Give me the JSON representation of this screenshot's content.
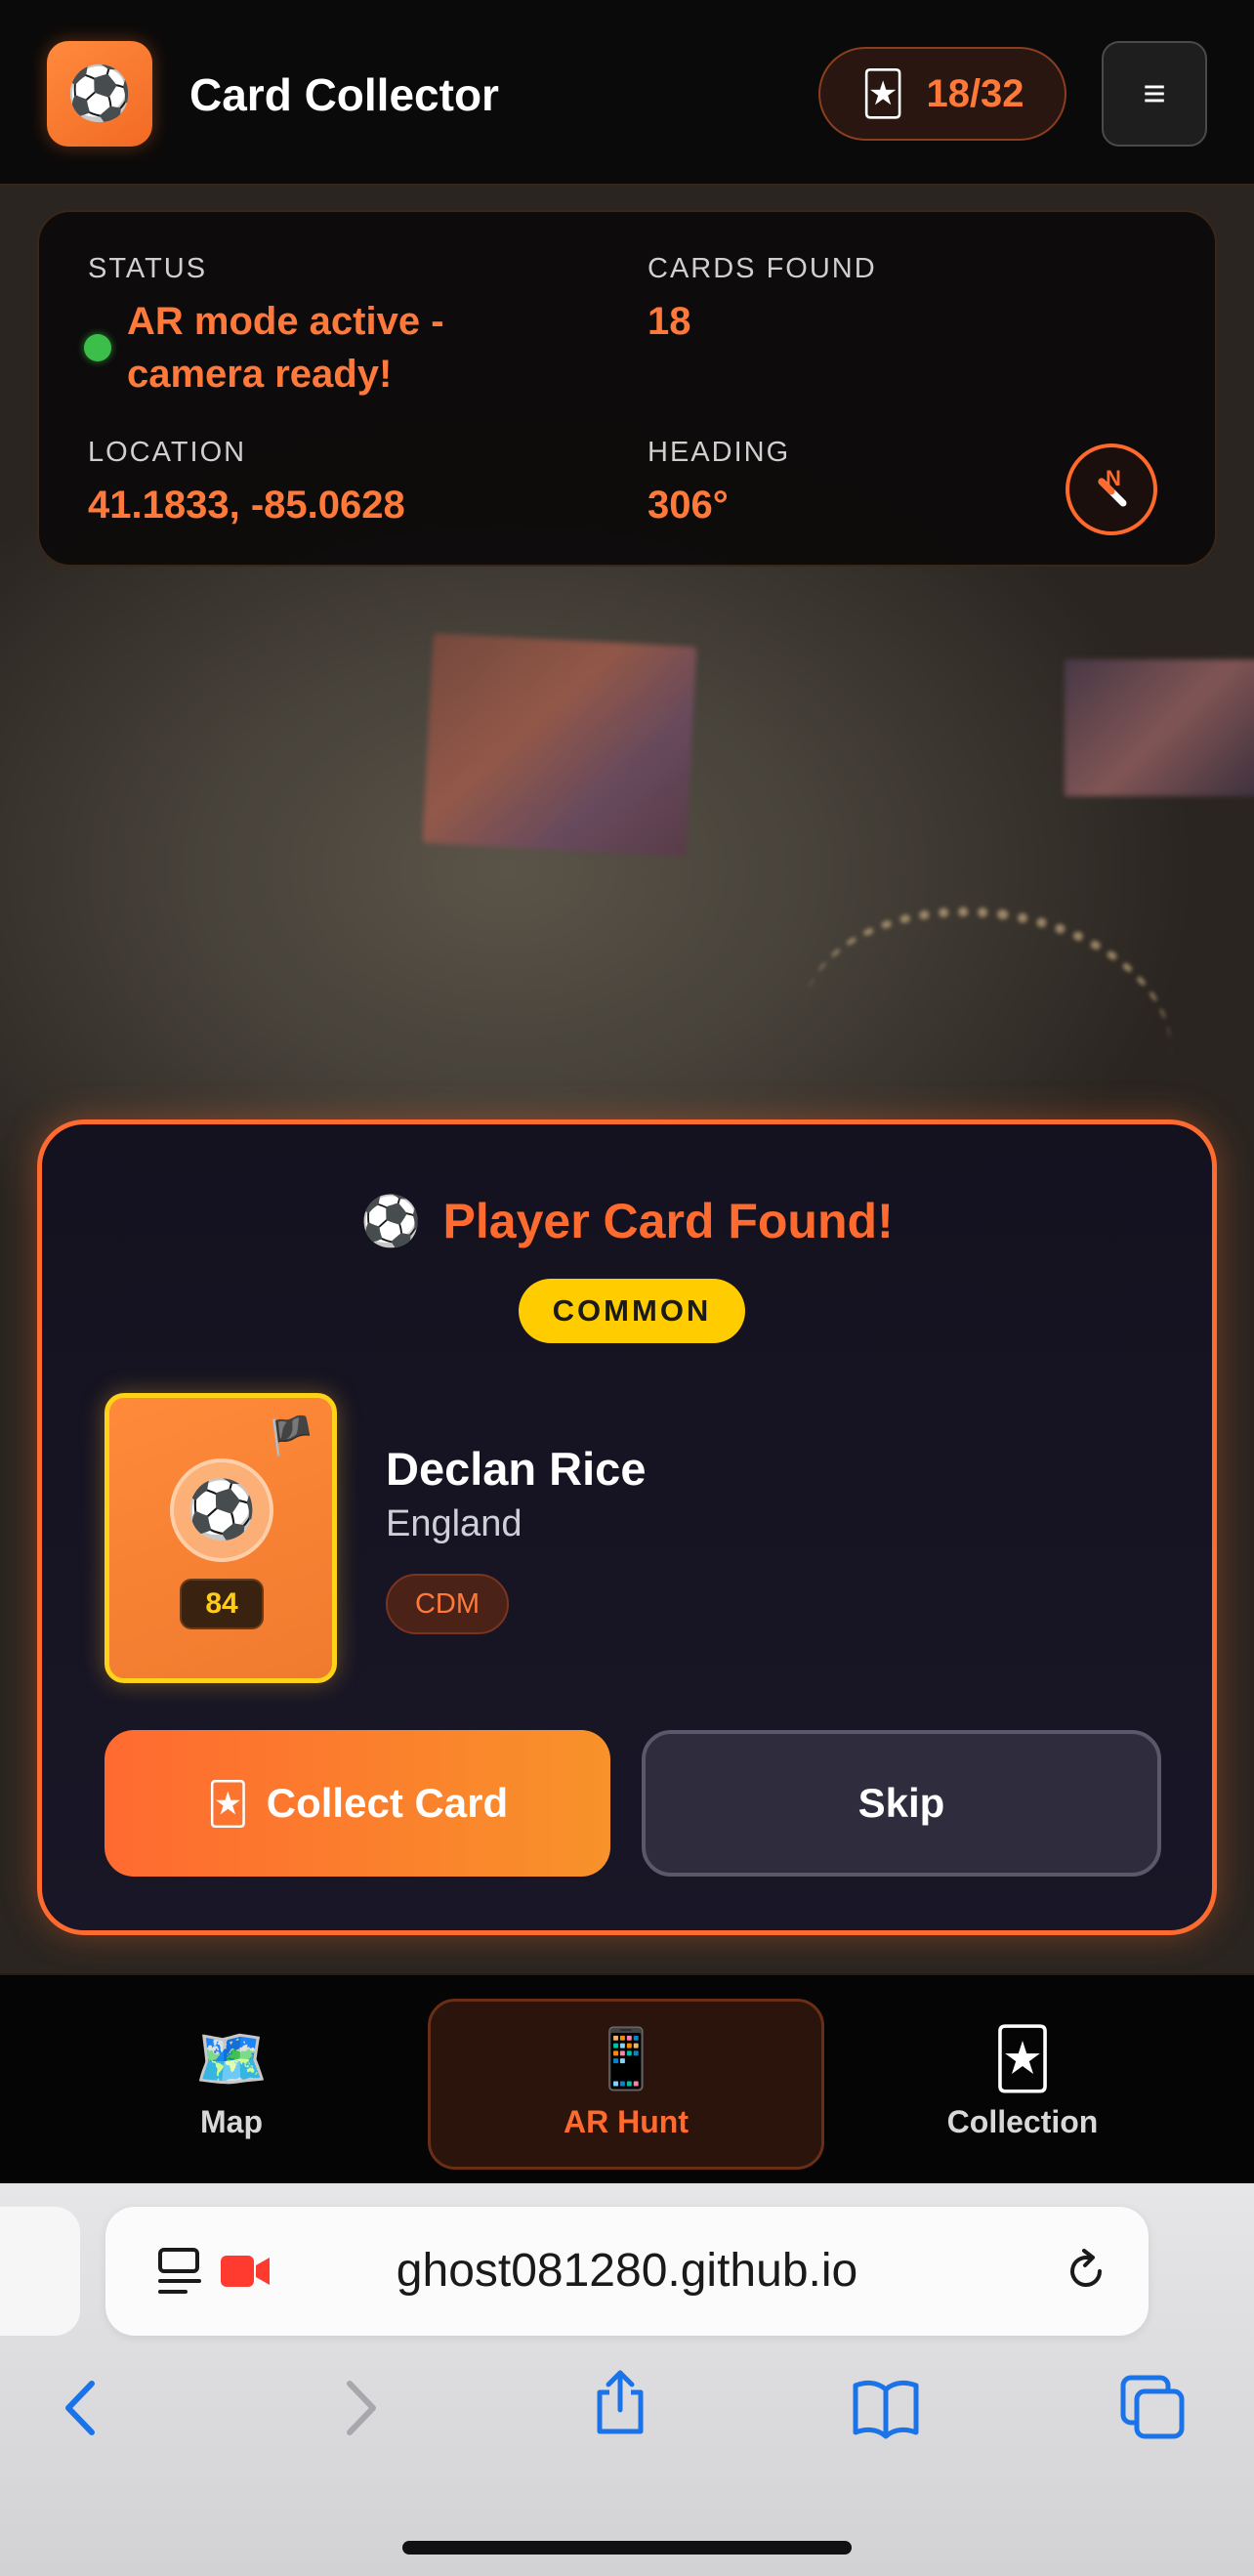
{
  "header": {
    "logo_icon": "⚽",
    "title": "Card Collector",
    "counter_icon": "🃏",
    "counter_text": "18/32",
    "menu_icon": "≡"
  },
  "status": {
    "status_label": "STATUS",
    "status_line1": "AR mode active -",
    "status_line2": "camera ready!",
    "cards_label": "CARDS FOUND",
    "cards_value": "18",
    "location_label": "LOCATION",
    "location_value": "41.1833, -85.0628",
    "heading_label": "HEADING",
    "heading_value": "306°",
    "compass_letter": "N"
  },
  "found": {
    "title_icon": "⚽",
    "title": "Player Card Found!",
    "rarity": "COMMON",
    "card_flag": "🏴",
    "card_ball": "⚽",
    "rating": "84",
    "player_name": "Declan Rice",
    "country": "England",
    "position": "CDM",
    "collect_icon": "🃏",
    "collect_label": "Collect Card",
    "skip_label": "Skip"
  },
  "tabs": [
    {
      "icon": "🗺️",
      "label": "Map"
    },
    {
      "icon": "📱",
      "label": "AR Hunt"
    },
    {
      "icon": "🃏",
      "label": "Collection"
    }
  ],
  "browser": {
    "url": "ghost081280.github.io"
  },
  "colors": {
    "accent": "#ff6b2e",
    "rarity": "#ffcc00",
    "status_dot": "#3cbf4a",
    "safari_blue": "#1a73e8"
  }
}
